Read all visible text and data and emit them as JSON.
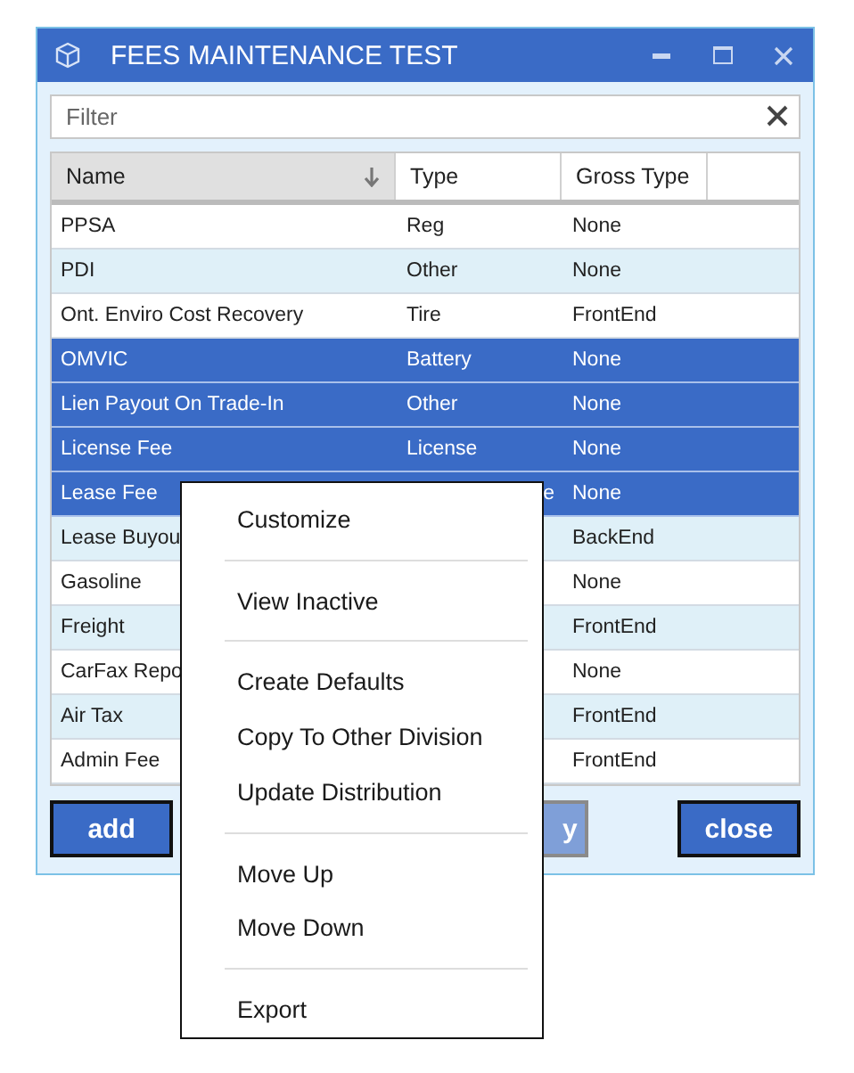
{
  "window": {
    "title": "FEES MAINTENANCE TEST"
  },
  "filter": {
    "placeholder": "Filter"
  },
  "table": {
    "columns": [
      {
        "label": "Name",
        "sorted": true
      },
      {
        "label": "Type",
        "sorted": false
      },
      {
        "label": "Gross Type",
        "sorted": false
      }
    ],
    "rows": [
      {
        "name": "PPSA",
        "type": "Reg",
        "gross_type": "None",
        "selected": false
      },
      {
        "name": "PDI",
        "type": "Other",
        "gross_type": "None",
        "selected": false
      },
      {
        "name": "Ont. Enviro Cost Recovery",
        "type": "Tire",
        "gross_type": "FrontEnd",
        "selected": false
      },
      {
        "name": "OMVIC",
        "type": "Battery",
        "gross_type": "None",
        "selected": true
      },
      {
        "name": "Lien Payout On Trade-In",
        "type": "Other",
        "gross_type": "None",
        "selected": true
      },
      {
        "name": "License Fee",
        "type": "License",
        "gross_type": "None",
        "selected": true
      },
      {
        "name": "Lease Fee",
        "type": "e",
        "type_cut": true,
        "gross_type": "None",
        "selected": true
      },
      {
        "name": "Lease Buyou",
        "gross_type": "BackEnd",
        "selected": false
      },
      {
        "name": "Gasoline",
        "gross_type": "None",
        "selected": false
      },
      {
        "name": "Freight",
        "gross_type": "FrontEnd",
        "selected": false
      },
      {
        "name": "CarFax Repo",
        "gross_type": "None",
        "selected": false
      },
      {
        "name": "Air Tax",
        "gross_type": "FrontEnd",
        "selected": false
      },
      {
        "name": "Admin Fee",
        "gross_type": "FrontEnd",
        "selected": false
      }
    ]
  },
  "buttons": [
    {
      "label": "add",
      "disabled": false
    },
    {
      "label": "y",
      "disabled": true
    },
    {
      "label": "close",
      "disabled": false
    }
  ],
  "context_menu": {
    "groups": [
      [
        "Customize"
      ],
      [
        "View Inactive"
      ],
      [
        "Create Defaults",
        "Copy To Other Division",
        "Update Distribution"
      ],
      [
        "Move Up",
        "Move Down"
      ],
      [
        "Export"
      ]
    ]
  }
}
